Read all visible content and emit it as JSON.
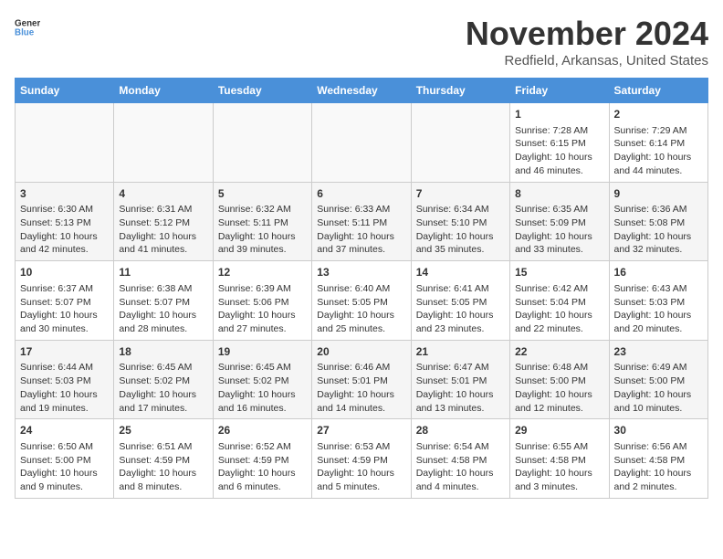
{
  "logo": {
    "line1": "General",
    "line2": "Blue"
  },
  "title": "November 2024",
  "location": "Redfield, Arkansas, United States",
  "headers": [
    "Sunday",
    "Monday",
    "Tuesday",
    "Wednesday",
    "Thursday",
    "Friday",
    "Saturday"
  ],
  "weeks": [
    [
      {
        "day": "",
        "info": ""
      },
      {
        "day": "",
        "info": ""
      },
      {
        "day": "",
        "info": ""
      },
      {
        "day": "",
        "info": ""
      },
      {
        "day": "",
        "info": ""
      },
      {
        "day": "1",
        "info": "Sunrise: 7:28 AM\nSunset: 6:15 PM\nDaylight: 10 hours and 46 minutes."
      },
      {
        "day": "2",
        "info": "Sunrise: 7:29 AM\nSunset: 6:14 PM\nDaylight: 10 hours and 44 minutes."
      }
    ],
    [
      {
        "day": "3",
        "info": "Sunrise: 6:30 AM\nSunset: 5:13 PM\nDaylight: 10 hours and 42 minutes."
      },
      {
        "day": "4",
        "info": "Sunrise: 6:31 AM\nSunset: 5:12 PM\nDaylight: 10 hours and 41 minutes."
      },
      {
        "day": "5",
        "info": "Sunrise: 6:32 AM\nSunset: 5:11 PM\nDaylight: 10 hours and 39 minutes."
      },
      {
        "day": "6",
        "info": "Sunrise: 6:33 AM\nSunset: 5:11 PM\nDaylight: 10 hours and 37 minutes."
      },
      {
        "day": "7",
        "info": "Sunrise: 6:34 AM\nSunset: 5:10 PM\nDaylight: 10 hours and 35 minutes."
      },
      {
        "day": "8",
        "info": "Sunrise: 6:35 AM\nSunset: 5:09 PM\nDaylight: 10 hours and 33 minutes."
      },
      {
        "day": "9",
        "info": "Sunrise: 6:36 AM\nSunset: 5:08 PM\nDaylight: 10 hours and 32 minutes."
      }
    ],
    [
      {
        "day": "10",
        "info": "Sunrise: 6:37 AM\nSunset: 5:07 PM\nDaylight: 10 hours and 30 minutes."
      },
      {
        "day": "11",
        "info": "Sunrise: 6:38 AM\nSunset: 5:07 PM\nDaylight: 10 hours and 28 minutes."
      },
      {
        "day": "12",
        "info": "Sunrise: 6:39 AM\nSunset: 5:06 PM\nDaylight: 10 hours and 27 minutes."
      },
      {
        "day": "13",
        "info": "Sunrise: 6:40 AM\nSunset: 5:05 PM\nDaylight: 10 hours and 25 minutes."
      },
      {
        "day": "14",
        "info": "Sunrise: 6:41 AM\nSunset: 5:05 PM\nDaylight: 10 hours and 23 minutes."
      },
      {
        "day": "15",
        "info": "Sunrise: 6:42 AM\nSunset: 5:04 PM\nDaylight: 10 hours and 22 minutes."
      },
      {
        "day": "16",
        "info": "Sunrise: 6:43 AM\nSunset: 5:03 PM\nDaylight: 10 hours and 20 minutes."
      }
    ],
    [
      {
        "day": "17",
        "info": "Sunrise: 6:44 AM\nSunset: 5:03 PM\nDaylight: 10 hours and 19 minutes."
      },
      {
        "day": "18",
        "info": "Sunrise: 6:45 AM\nSunset: 5:02 PM\nDaylight: 10 hours and 17 minutes."
      },
      {
        "day": "19",
        "info": "Sunrise: 6:45 AM\nSunset: 5:02 PM\nDaylight: 10 hours and 16 minutes."
      },
      {
        "day": "20",
        "info": "Sunrise: 6:46 AM\nSunset: 5:01 PM\nDaylight: 10 hours and 14 minutes."
      },
      {
        "day": "21",
        "info": "Sunrise: 6:47 AM\nSunset: 5:01 PM\nDaylight: 10 hours and 13 minutes."
      },
      {
        "day": "22",
        "info": "Sunrise: 6:48 AM\nSunset: 5:00 PM\nDaylight: 10 hours and 12 minutes."
      },
      {
        "day": "23",
        "info": "Sunrise: 6:49 AM\nSunset: 5:00 PM\nDaylight: 10 hours and 10 minutes."
      }
    ],
    [
      {
        "day": "24",
        "info": "Sunrise: 6:50 AM\nSunset: 5:00 PM\nDaylight: 10 hours and 9 minutes."
      },
      {
        "day": "25",
        "info": "Sunrise: 6:51 AM\nSunset: 4:59 PM\nDaylight: 10 hours and 8 minutes."
      },
      {
        "day": "26",
        "info": "Sunrise: 6:52 AM\nSunset: 4:59 PM\nDaylight: 10 hours and 6 minutes."
      },
      {
        "day": "27",
        "info": "Sunrise: 6:53 AM\nSunset: 4:59 PM\nDaylight: 10 hours and 5 minutes."
      },
      {
        "day": "28",
        "info": "Sunrise: 6:54 AM\nSunset: 4:58 PM\nDaylight: 10 hours and 4 minutes."
      },
      {
        "day": "29",
        "info": "Sunrise: 6:55 AM\nSunset: 4:58 PM\nDaylight: 10 hours and 3 minutes."
      },
      {
        "day": "30",
        "info": "Sunrise: 6:56 AM\nSunset: 4:58 PM\nDaylight: 10 hours and 2 minutes."
      }
    ]
  ]
}
